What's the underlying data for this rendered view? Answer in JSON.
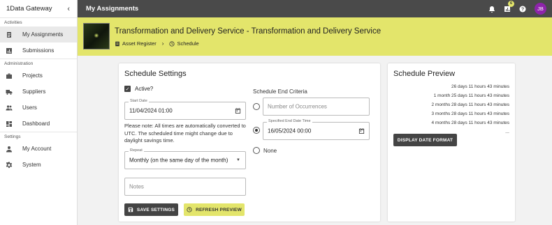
{
  "app": {
    "name": "1Data Gateway",
    "collapse_icon": "chevron-left-icon"
  },
  "sidebar": {
    "sections": [
      {
        "title": "Activities",
        "items": [
          {
            "label": "My Assignments",
            "icon": "assignment-icon",
            "active": true
          },
          {
            "label": "Submissions",
            "icon": "chart-icon",
            "active": false
          }
        ]
      },
      {
        "title": "Administration",
        "items": [
          {
            "label": "Projects",
            "icon": "briefcase-icon",
            "active": false
          },
          {
            "label": "Suppliers",
            "icon": "truck-icon",
            "active": false
          },
          {
            "label": "Users",
            "icon": "people-icon",
            "active": false
          },
          {
            "label": "Dashboard",
            "icon": "dashboard-icon",
            "active": false
          }
        ]
      },
      {
        "title": "Settings",
        "items": [
          {
            "label": "My Account",
            "icon": "person-icon",
            "active": false
          },
          {
            "label": "System",
            "icon": "gear-icon",
            "active": false
          }
        ]
      }
    ]
  },
  "topbar": {
    "title": "My Assignments",
    "badge_count": "6",
    "avatar_initials": "JB",
    "avatar_color": "#8e24aa"
  },
  "header": {
    "title": "Transformation and Delivery Service - Transformation and Delivery Service",
    "breadcrumb": {
      "first": "Asset Register",
      "second": "Schedule"
    },
    "band_color": "#e3e56b"
  },
  "schedule_settings": {
    "title": "Schedule Settings",
    "active_label": "Active?",
    "active_checked": true,
    "start_date": {
      "label": "Start Date",
      "value": "11/04/2024 01:00"
    },
    "note": "Please note: All times are automatically converted to UTC. The scheduled time might change due to daylight savings time.",
    "repeat": {
      "label": "Repeat",
      "value": "Monthly (on the same day of the month)"
    },
    "notes": {
      "placeholder": "Notes"
    },
    "save_label": "SAVE SETTINGS",
    "refresh_label": "REFRESH PREVIEW",
    "end_criteria": {
      "title": "Schedule End Criteria",
      "occurrences_placeholder": "Number of Occurrences",
      "end_date": {
        "label": "Specified End Date Time",
        "value": "16/05/2024 00:00"
      },
      "none_label": "None",
      "selected": "end_date"
    }
  },
  "schedule_preview": {
    "title": "Schedule Preview",
    "items": [
      "26 days 11 hours 43 minutes",
      "1 month 25 days 11 hours 43 minutes",
      "2 months 28 days 11 hours 43 minutes",
      "3 months 28 days 11 hours 43 minutes",
      "4 months 28 days 11 hours 43 minutes"
    ],
    "more": "...",
    "display_format_label": "DISPLAY DATE FORMAT"
  }
}
